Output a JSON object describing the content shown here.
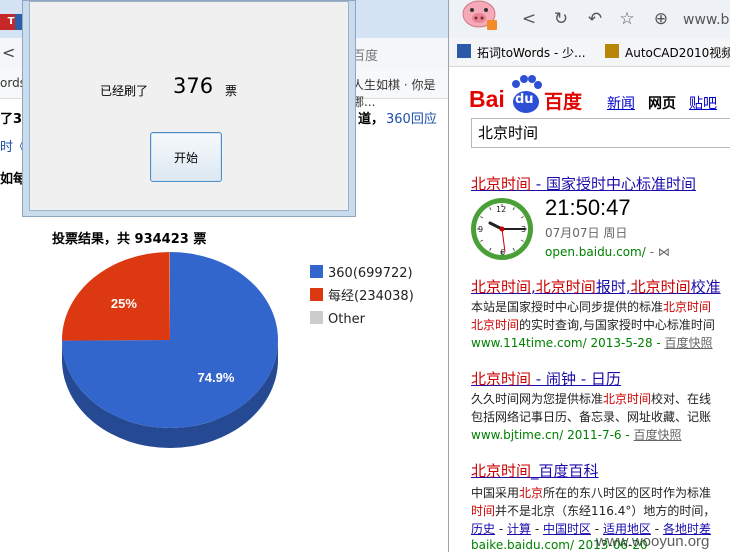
{
  "left_window": {
    "tab_icon_text": "T",
    "tab_peek": "1",
    "nav_back_glyph": "<",
    "address_peek": "百度",
    "bookmark_peek": "ords",
    "bookmark_peek2": "人生如棋 · 你是哪...",
    "article": {
      "line1_left": "了36",
      "line1_right": "道，",
      "line1_link": "360回应",
      "line2_left": "时《",
      "line3_left": "如每"
    }
  },
  "dialog": {
    "already_label": "已经刷了",
    "count": "376",
    "unit": "票",
    "start_button": "开始"
  },
  "chart_data": {
    "type": "pie",
    "title": "投票结果，共 934423 票",
    "slices": [
      {
        "label": "360(699722)",
        "value": 699722,
        "percent_label": "74.9%",
        "color": "#3366cc"
      },
      {
        "label": "每经(234038)",
        "value": 234038,
        "percent_label": "25%",
        "color": "#dc3912"
      },
      {
        "label": "Other",
        "value": 663,
        "percent_label": "",
        "color": "#cccccc"
      }
    ],
    "legend_position": "right"
  },
  "right_window": {
    "toolbar": {
      "back_glyph": "<",
      "refresh_glyph": "↻",
      "undo_glyph": "↶",
      "star_glyph": "☆",
      "shield_glyph": "⊕",
      "address_peek": "www.b"
    },
    "bookmarks": [
      {
        "label": "拓词toWords - 少...",
        "icon": "bookmark-icon",
        "color": "#2b5aa8"
      },
      {
        "label": "AutoCAD2010视频",
        "icon": "autocad-icon",
        "color": "#b8860b"
      }
    ],
    "baidu": {
      "logo_bai": "Bai",
      "logo_du": "du",
      "logo_cn": "百度",
      "nav": [
        {
          "label": "新闻",
          "active": false
        },
        {
          "label": "网页",
          "active": true
        },
        {
          "label": "贴吧",
          "active": false
        }
      ],
      "search_value": "北京时间"
    },
    "results": [
      {
        "title": [
          {
            "t": "北京时间",
            "hl": true
          },
          {
            "t": " - 国家授时中心标准时间",
            "hl": false
          }
        ],
        "clock_time": "21:50:47",
        "clock_date": "07月07日  周日",
        "url": "open.baidu.com/",
        "url_suffix": " - ⋈"
      },
      {
        "title": [
          {
            "t": "北京时间",
            "hl": true
          },
          {
            "t": ",",
            "hl": false
          },
          {
            "t": "北京时间",
            "hl": true
          },
          {
            "t": "报时,",
            "hl": false
          },
          {
            "t": "北京时间",
            "hl": true
          },
          {
            "t": "校准",
            "hl": false
          }
        ],
        "snippet1": [
          {
            "t": "本站是国家授时中心同步提供的标准",
            "hl": false
          },
          {
            "t": "北京时间",
            "hl": true
          }
        ],
        "snippet2": [
          {
            "t": "北京时间",
            "hl": true
          },
          {
            "t": "的实时查询,与国家授时中心标准时间",
            "hl": false
          }
        ],
        "url": "www.114time.com/ 2013-5-28",
        "snapshot": "百度快照"
      },
      {
        "title": [
          {
            "t": "北京时间",
            "hl": true
          },
          {
            "t": " - 闹钟 - 日历",
            "hl": false
          }
        ],
        "snippet1": [
          {
            "t": "久久时间网为您提供标准",
            "hl": false
          },
          {
            "t": "北京时间",
            "hl": true
          },
          {
            "t": "校对、在线",
            "hl": false
          }
        ],
        "snippet2": [
          {
            "t": "包括网络记事日历、备忘录、网址收藏、记账",
            "hl": false
          }
        ],
        "url": "www.bjtime.cn/ 2011-7-6",
        "snapshot": "百度快照"
      },
      {
        "title": [
          {
            "t": "北京时间",
            "hl": true
          },
          {
            "t": "_百度百科",
            "hl": false
          }
        ],
        "snippet1": [
          {
            "t": "中国采用",
            "hl": false
          },
          {
            "t": "北京",
            "hl": true
          },
          {
            "t": "所在的东八时区的区时作为标准",
            "hl": false
          }
        ],
        "snippet2": [
          {
            "t": "时间",
            "hl": true
          },
          {
            "t": "并不是北京（东经116.4°）地方的时间，",
            "hl": false
          }
        ],
        "links": [
          "历史",
          "计算",
          "中国时区",
          "适用地区",
          "各地时差"
        ],
        "url": "baike.baidu.com/ 2013-06-20"
      }
    ]
  },
  "watermark": "www.wooyun.org"
}
